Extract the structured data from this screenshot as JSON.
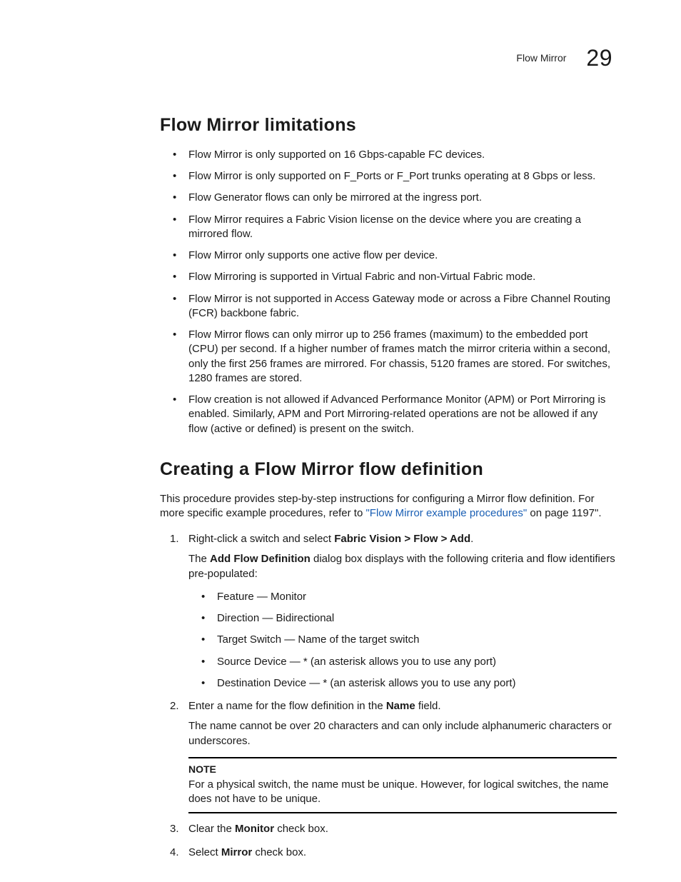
{
  "header": {
    "running_head": "Flow Mirror",
    "page_number": "29"
  },
  "section1": {
    "title": "Flow Mirror limitations",
    "bullets": [
      "Flow Mirror is only supported on 16 Gbps-capable FC devices.",
      "Flow Mirror is only supported on F_Ports or F_Port trunks operating at 8 Gbps or less.",
      "Flow Generator flows can only be mirrored at the ingress port.",
      "Flow Mirror requires a Fabric Vision license on the device where you are creating a mirrored flow.",
      "Flow Mirror only supports one active flow per device.",
      "Flow Mirroring is supported in Virtual Fabric and non-Virtual Fabric mode.",
      "Flow Mirror is not supported in Access Gateway mode or across a Fibre Channel Routing (FCR) backbone fabric.",
      "Flow Mirror flows can only mirror up to 256 frames (maximum) to the embedded port (CPU) per second. If a higher number of frames match the mirror criteria within a second, only the first 256 frames are mirrored. For chassis, 5120 frames are stored. For switches, 1280 frames are stored.",
      "Flow creation is not allowed if Advanced Performance Monitor (APM) or Port Mirroring is enabled. Similarly, APM and Port Mirroring-related operations are not be allowed if any flow (active or defined) is present on the switch."
    ]
  },
  "section2": {
    "title": "Creating a Flow Mirror flow definition",
    "intro_pre": "This procedure provides step-by-step instructions for configuring a Mirror flow definition. For more specific example procedures, refer to ",
    "intro_link": "\"Flow Mirror example procedures\"",
    "intro_post": " on page 1197\".",
    "step1": {
      "lead_pre": "Right-click a switch and select ",
      "lead_bold": "Fabric Vision > Flow > Add",
      "lead_post": ".",
      "para_pre": "The ",
      "para_bold": "Add Flow Definition",
      "para_post": " dialog box displays with the following criteria and flow identifiers pre-populated:",
      "sub": [
        "Feature — Monitor",
        "Direction — Bidirectional",
        "Target Switch — Name of the target switch",
        "Source Device — * (an asterisk allows you to use any port)",
        "Destination Device — * (an asterisk allows you to use any port)"
      ]
    },
    "step2": {
      "lead_pre": "Enter a name for the flow definition in the ",
      "lead_bold": "Name",
      "lead_post": " field.",
      "para": "The name cannot be over 20 characters and can only include alphanumeric characters or underscores.",
      "note_label": "NOTE",
      "note_text": "For a physical switch, the name must be unique. However, for logical switches, the name does not have to be unique."
    },
    "step3": {
      "pre": "Clear the ",
      "bold": "Monitor",
      "post": " check box."
    },
    "step4": {
      "pre": "Select ",
      "bold": "Mirror",
      "post": " check box."
    }
  }
}
